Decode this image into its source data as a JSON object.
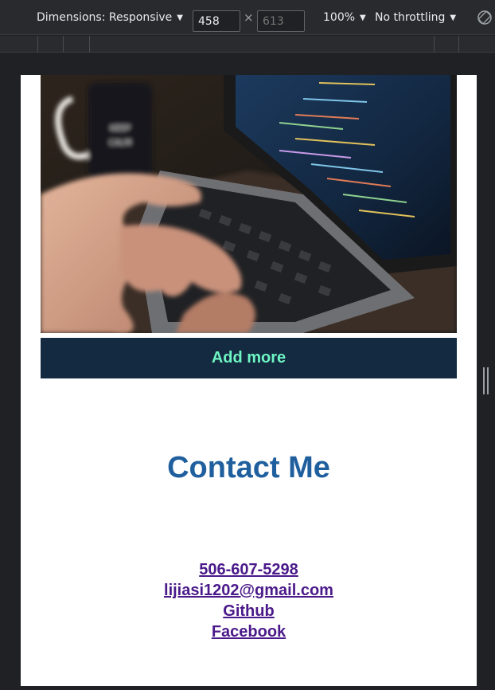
{
  "devtools": {
    "dimensions_label": "Dimensions: Responsive",
    "width_value": "458",
    "height_placeholder": "613",
    "times_symbol": "×",
    "zoom_label": "100%",
    "throttling_label": "No throttling",
    "caret": "▼"
  },
  "page": {
    "hero_image_icon": "laptop-coding-photo",
    "add_button_label": "Add more",
    "contact_title": "Contact Me",
    "contacts": [
      {
        "label": "506-607-5298"
      },
      {
        "label": "lijiasi1202@gmail.com"
      },
      {
        "label": "Github"
      },
      {
        "label": "Facebook"
      }
    ]
  },
  "colors": {
    "button_bg": "#132a40",
    "button_text": "#6ff5c4",
    "title": "#1f5f9e",
    "link": "#4b1a8a"
  }
}
